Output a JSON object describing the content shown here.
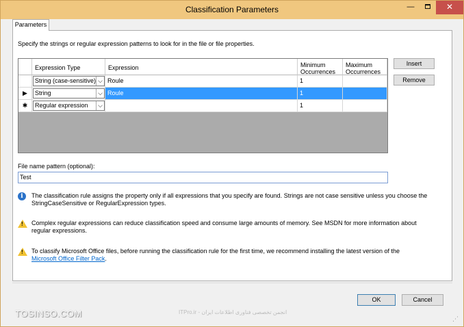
{
  "window": {
    "title": "Classification Parameters",
    "minimize_glyph": "—",
    "close_glyph": "✕"
  },
  "tabs": [
    {
      "label": "Parameters"
    }
  ],
  "intro_text": "Specify the strings or regular expression patterns to look for in the file or file properties.",
  "grid": {
    "columns": {
      "type": "Expression Type",
      "expression": "Expression",
      "min": "Minimum Occurrences",
      "max": "Maximum Occurrences"
    },
    "rows": [
      {
        "marker": "",
        "type": "String (case-sensitive)",
        "expression": "Roule",
        "min": "1",
        "max": "",
        "selected": false
      },
      {
        "marker": "▶",
        "type": "String",
        "expression": "Roule",
        "min": "1",
        "max": "",
        "selected": true
      },
      {
        "marker": "✱",
        "type": "Regular expression",
        "expression": "",
        "min": "1",
        "max": "",
        "selected": false
      }
    ]
  },
  "buttons": {
    "insert": "Insert",
    "remove": "Remove",
    "ok": "OK",
    "cancel": "Cancel"
  },
  "filename": {
    "label": "File name pattern (optional):",
    "value": "Test"
  },
  "notes": {
    "info": "The classification rule assigns the property only if all expressions that you specify are found. Strings are not case sensitive unless you choose the StringCaseSensitive or RegularExpression types.",
    "warn1": "Complex regular expressions can reduce classification speed and consume large amounts of memory. See MSDN for more information about regular expressions.",
    "warn2": "To classify Microsoft Office files, before running the classification rule for the first time, we recommend installing the latest version of the",
    "warn2_link": "Microsoft Office Filter Pack",
    "warn2_tail": "."
  },
  "watermark": {
    "left": "TOSINSO.COM",
    "center": "ITPro.ir - انجمن تخصصی فناوری اطلاعات ایران"
  },
  "colors": {
    "titlebar": "#f0c77f",
    "selection": "#3399ff",
    "close": "#c7504b"
  },
  "icons": {
    "info": "info-icon",
    "warning": "warning-icon",
    "current-row": "row-arrow-icon",
    "new-row": "new-row-star-icon"
  }
}
